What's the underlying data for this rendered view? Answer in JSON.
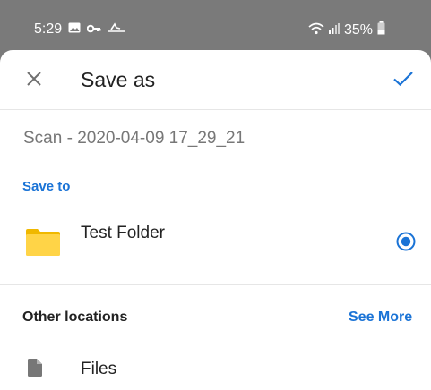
{
  "status_bar": {
    "time": "5:29",
    "battery": "35%",
    "icons": [
      "gallery-icon",
      "key-icon",
      "signal-tilde-icon",
      "wifi-icon",
      "cell-signal-icon",
      "battery-icon"
    ]
  },
  "dialog": {
    "title": "Save as",
    "close_icon": "close-icon",
    "confirm_icon": "checkmark-icon",
    "accent_color": "#1a73d6"
  },
  "filename": "Scan - 2020-04-09 17_29_21",
  "save_to": {
    "label": "Save to",
    "folder": {
      "name": "Test Folder",
      "icon": "folder-icon",
      "selected": true
    }
  },
  "other_locations": {
    "label": "Other locations",
    "see_more_label": "See More",
    "items": [
      {
        "name": "Files",
        "icon": "file-icon"
      }
    ]
  }
}
